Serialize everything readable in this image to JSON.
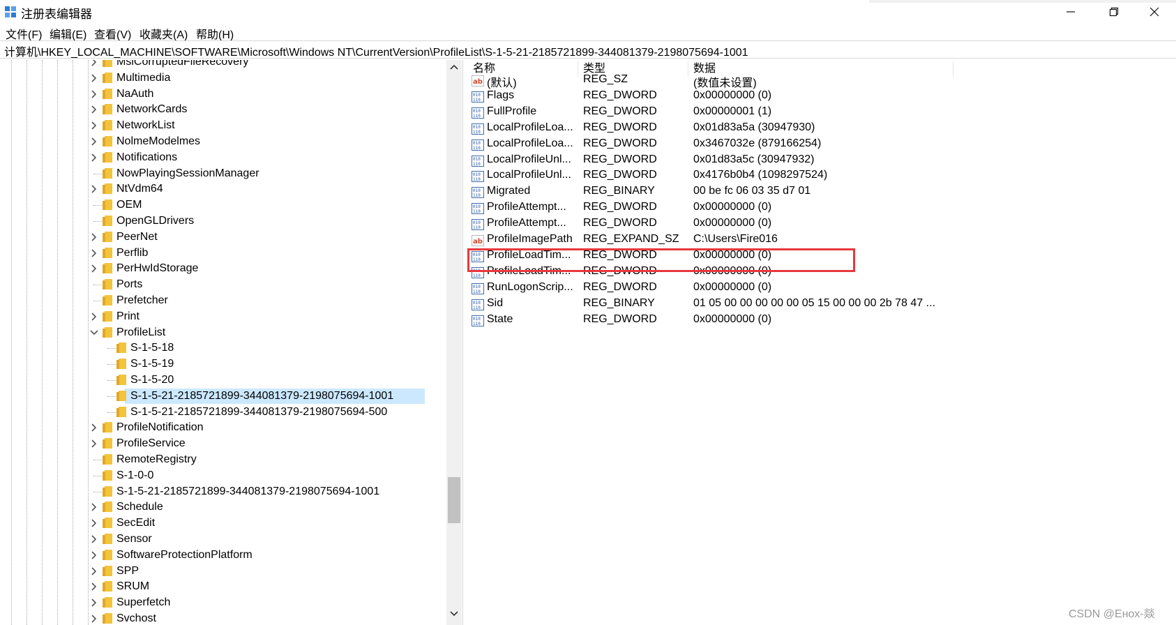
{
  "window": {
    "title": "注册表编辑器",
    "controls": {
      "minimize": "–",
      "maximize": "❐",
      "close": "✕"
    }
  },
  "menu": [
    "文件(F)",
    "编辑(E)",
    "查看(V)",
    "收藏夹(A)",
    "帮助(H)"
  ],
  "address": "计算机\\HKEY_LOCAL_MACHINE\\SOFTWARE\\Microsoft\\Windows NT\\CurrentVersion\\ProfileList\\S-1-5-21-2185721899-344081379-2198075694-1001",
  "tree": {
    "items": [
      {
        "label": "MsiCorruptedFileRecovery",
        "level": 0,
        "expander": "collapsed"
      },
      {
        "label": "Multimedia",
        "level": 0,
        "expander": "collapsed"
      },
      {
        "label": "NaAuth",
        "level": 0,
        "expander": "collapsed"
      },
      {
        "label": "NetworkCards",
        "level": 0,
        "expander": "collapsed"
      },
      {
        "label": "NetworkList",
        "level": 0,
        "expander": "collapsed"
      },
      {
        "label": "NolmeModelmes",
        "level": 0,
        "expander": "collapsed"
      },
      {
        "label": "Notifications",
        "level": 0,
        "expander": "collapsed"
      },
      {
        "label": "NowPlayingSessionManager",
        "level": 0,
        "expander": "none"
      },
      {
        "label": "NtVdm64",
        "level": 0,
        "expander": "collapsed"
      },
      {
        "label": "OEM",
        "level": 0,
        "expander": "none"
      },
      {
        "label": "OpenGLDrivers",
        "level": 0,
        "expander": "none"
      },
      {
        "label": "PeerNet",
        "level": 0,
        "expander": "collapsed"
      },
      {
        "label": "Perflib",
        "level": 0,
        "expander": "collapsed"
      },
      {
        "label": "PerHwIdStorage",
        "level": 0,
        "expander": "collapsed"
      },
      {
        "label": "Ports",
        "level": 0,
        "expander": "none"
      },
      {
        "label": "Prefetcher",
        "level": 0,
        "expander": "none"
      },
      {
        "label": "Print",
        "level": 0,
        "expander": "collapsed"
      },
      {
        "label": "ProfileList",
        "level": 0,
        "expander": "expanded"
      },
      {
        "label": "S-1-5-18",
        "level": 1,
        "expander": "none"
      },
      {
        "label": "S-1-5-19",
        "level": 1,
        "expander": "none"
      },
      {
        "label": "S-1-5-20",
        "level": 1,
        "expander": "none"
      },
      {
        "label": "S-1-5-21-2185721899-344081379-2198075694-1001",
        "level": 1,
        "expander": "none",
        "selected": true
      },
      {
        "label": "S-1-5-21-2185721899-344081379-2198075694-500",
        "level": 1,
        "expander": "none"
      },
      {
        "label": "ProfileNotification",
        "level": 0,
        "expander": "collapsed"
      },
      {
        "label": "ProfileService",
        "level": 0,
        "expander": "collapsed"
      },
      {
        "label": "RemoteRegistry",
        "level": 0,
        "expander": "none"
      },
      {
        "label": "S-1-0-0",
        "level": 0,
        "expander": "none"
      },
      {
        "label": "S-1-5-21-2185721899-344081379-2198075694-1001",
        "level": 0,
        "expander": "none"
      },
      {
        "label": "Schedule",
        "level": 0,
        "expander": "collapsed"
      },
      {
        "label": "SecEdit",
        "level": 0,
        "expander": "collapsed"
      },
      {
        "label": "Sensor",
        "level": 0,
        "expander": "collapsed"
      },
      {
        "label": "SoftwareProtectionPlatform",
        "level": 0,
        "expander": "collapsed"
      },
      {
        "label": "SPP",
        "level": 0,
        "expander": "collapsed"
      },
      {
        "label": "SRUM",
        "level": 0,
        "expander": "collapsed"
      },
      {
        "label": "Superfetch",
        "level": 0,
        "expander": "collapsed"
      },
      {
        "label": "Svchost",
        "level": 0,
        "expander": "collapsed"
      }
    ]
  },
  "values": {
    "headers": {
      "name": "名称",
      "type": "类型",
      "data": "数据"
    },
    "rows": [
      {
        "icon": "string-value-icon",
        "name": "(默认)",
        "type": "REG_SZ",
        "data": "(数值未设置)"
      },
      {
        "icon": "binary-value-icon",
        "name": "Flags",
        "type": "REG_DWORD",
        "data": "0x00000000 (0)"
      },
      {
        "icon": "binary-value-icon",
        "name": "FullProfile",
        "type": "REG_DWORD",
        "data": "0x00000001 (1)"
      },
      {
        "icon": "binary-value-icon",
        "name": "LocalProfileLoa...",
        "type": "REG_DWORD",
        "data": "0x01d83a5a (30947930)"
      },
      {
        "icon": "binary-value-icon",
        "name": "LocalProfileLoa...",
        "type": "REG_DWORD",
        "data": "0x3467032e (879166254)"
      },
      {
        "icon": "binary-value-icon",
        "name": "LocalProfileUnl...",
        "type": "REG_DWORD",
        "data": "0x01d83a5c (30947932)"
      },
      {
        "icon": "binary-value-icon",
        "name": "LocalProfileUnl...",
        "type": "REG_DWORD",
        "data": "0x4176b0b4 (1098297524)"
      },
      {
        "icon": "binary-value-icon",
        "name": "Migrated",
        "type": "REG_BINARY",
        "data": "00 be fc 06 03 35 d7 01"
      },
      {
        "icon": "binary-value-icon",
        "name": "ProfileAttempt...",
        "type": "REG_DWORD",
        "data": "0x00000000 (0)"
      },
      {
        "icon": "binary-value-icon",
        "name": "ProfileAttempt...",
        "type": "REG_DWORD",
        "data": "0x00000000 (0)"
      },
      {
        "icon": "string-value-icon",
        "name": "ProfileImagePath",
        "type": "REG_EXPAND_SZ",
        "data": "C:\\Users\\Fire016"
      },
      {
        "icon": "binary-value-icon",
        "name": "ProfileLoadTim...",
        "type": "REG_DWORD",
        "data": "0x00000000 (0)"
      },
      {
        "icon": "binary-value-icon",
        "name": "ProfileLoadTim...",
        "type": "REG_DWORD",
        "data": "0x00000000 (0)"
      },
      {
        "icon": "binary-value-icon",
        "name": "RunLogonScrip...",
        "type": "REG_DWORD",
        "data": "0x00000000 (0)"
      },
      {
        "icon": "binary-value-icon",
        "name": "Sid",
        "type": "REG_BINARY",
        "data": "01 05 00 00 00 00 00 05 15 00 00 00 2b 78 47 ..."
      },
      {
        "icon": "binary-value-icon",
        "name": "State",
        "type": "REG_DWORD",
        "data": "0x00000000 (0)"
      }
    ]
  },
  "highlight_color": "#e8383d",
  "selection_color": "#cce8ff",
  "folder_color": "#f3c33c",
  "watermark": "CSDN @Eнох-燚"
}
